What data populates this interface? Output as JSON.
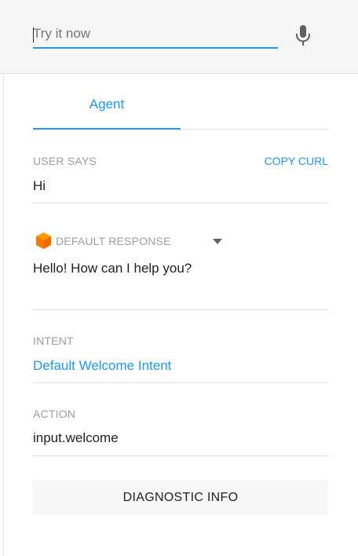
{
  "try_it": {
    "placeholder": "Try it now"
  },
  "tabs": [
    {
      "label": "Agent"
    }
  ],
  "user_says": {
    "label": "USER SAYS",
    "value": "Hi",
    "copy_curl": "COPY CURL"
  },
  "default_response": {
    "label": "DEFAULT RESPONSE",
    "value": "Hello! How can I help you?"
  },
  "intent": {
    "label": "INTENT",
    "value": "Default Welcome Intent"
  },
  "action": {
    "label": "ACTION",
    "value": "input.welcome"
  },
  "diagnostic": {
    "label": "DIAGNOSTIC INFO"
  },
  "colors": {
    "accent": "#2196f3",
    "cube": "#f57c00",
    "header_bg": "#f5f5f5"
  },
  "icons": {
    "mic": "microphone-icon",
    "cube": "agent-cube-icon",
    "dropdown": "dropdown-arrow-icon"
  }
}
